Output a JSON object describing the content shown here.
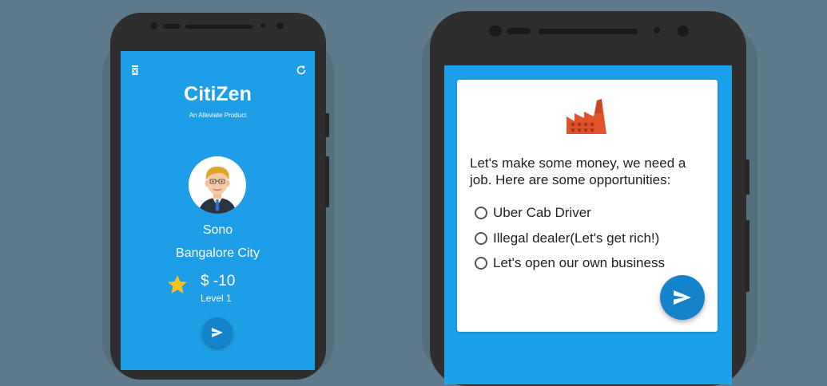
{
  "left_screen": {
    "top_left_icon": "trash-icon",
    "top_right_icon": "refresh-icon",
    "app_title": "CitiZen",
    "app_subtitle": "An Alleviate Product",
    "avatar_icon": "businessman-avatar",
    "player_name": "Sono",
    "city": "Bangalore City",
    "money_icon": "star-icon",
    "money": "$ -10",
    "level": "Level 1",
    "send_icon": "send-icon"
  },
  "right_screen": {
    "image_icon": "factory-icon",
    "question": "Let's make some money, we need a job. Here are some opportunities:",
    "options": [
      {
        "label": "Uber Cab Driver",
        "selected": false
      },
      {
        "label": "Illegal dealer(Let's get rich!)",
        "selected": false
      },
      {
        "label": "Let's open our own business",
        "selected": false
      }
    ],
    "send_icon": "send-icon"
  },
  "colors": {
    "background": "#5f7a8a",
    "screen_blue": "#1ca0ea",
    "fab_blue": "#1582cc",
    "factory_red": "#e2532b",
    "star_yellow": "#f9c21f"
  }
}
